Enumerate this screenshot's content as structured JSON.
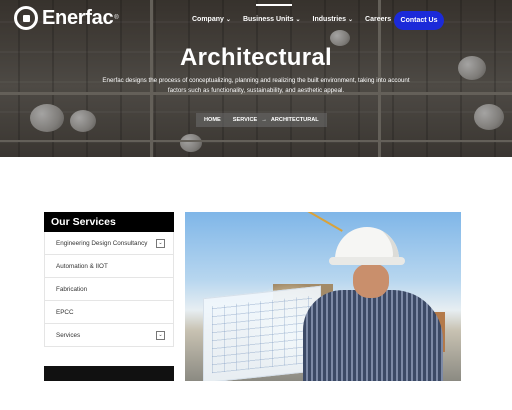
{
  "brand": {
    "name": "Enerfac",
    "reg": "®"
  },
  "nav": {
    "items": [
      {
        "label": "Company",
        "chev": "⌄"
      },
      {
        "label": "Business Units",
        "chev": "⌄"
      },
      {
        "label": "Industries",
        "chev": "⌄"
      },
      {
        "label": "Careers",
        "chev": "⌄"
      }
    ],
    "contact": "Contact Us"
  },
  "hero": {
    "title": "Architectural",
    "description": "Enerfac designs the process of conceptualizing, planning and realizing the built environment, taking into account factors such as functionality, sustainability, and aesthetic appeal.",
    "breadcrumb": [
      "HOME",
      "SERVICE",
      "ARCHITECTURAL"
    ],
    "breadcrumb_sep": "→"
  },
  "services": {
    "title": "Our Services",
    "items": [
      {
        "label": "Engineering Design Consultancy",
        "toggle": "⌄"
      },
      {
        "label": "Automation & IIOT",
        "toggle": ""
      },
      {
        "label": "Fabrication",
        "toggle": ""
      },
      {
        "label": "EPCC",
        "toggle": ""
      },
      {
        "label": "Services",
        "toggle": "⌄"
      }
    ]
  },
  "colors": {
    "accent": "#1b2ad9",
    "dark": "#000000"
  }
}
